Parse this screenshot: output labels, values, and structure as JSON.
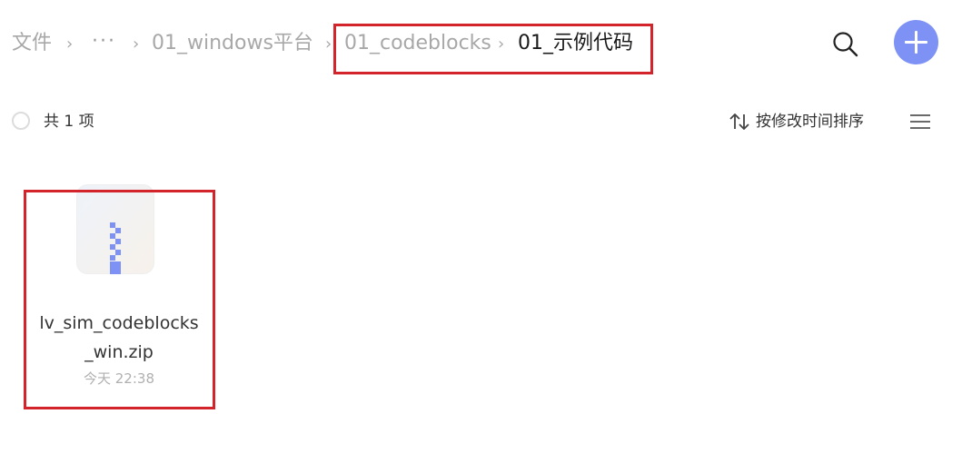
{
  "breadcrumb": {
    "root": "文件",
    "more": "···",
    "items": [
      "01_windows平台",
      "01_codeblocks"
    ],
    "current": "01_示例代码",
    "separator": "›"
  },
  "toolbar": {
    "search_icon": "search-icon",
    "add_icon": "plus-icon"
  },
  "list_header": {
    "count_text": "共 1 项",
    "sort_label": "按修改时间排序",
    "sort_icon": "sort-arrows-icon",
    "view_icon": "list-view-icon"
  },
  "files": [
    {
      "name_line1": "lv_sim_codeblocks",
      "name_line2": "_win.zip",
      "date": "今天 22:38",
      "icon": "zip-file-icon"
    }
  ],
  "colors": {
    "accent": "#7d92f4",
    "highlight": "#d3242c"
  }
}
